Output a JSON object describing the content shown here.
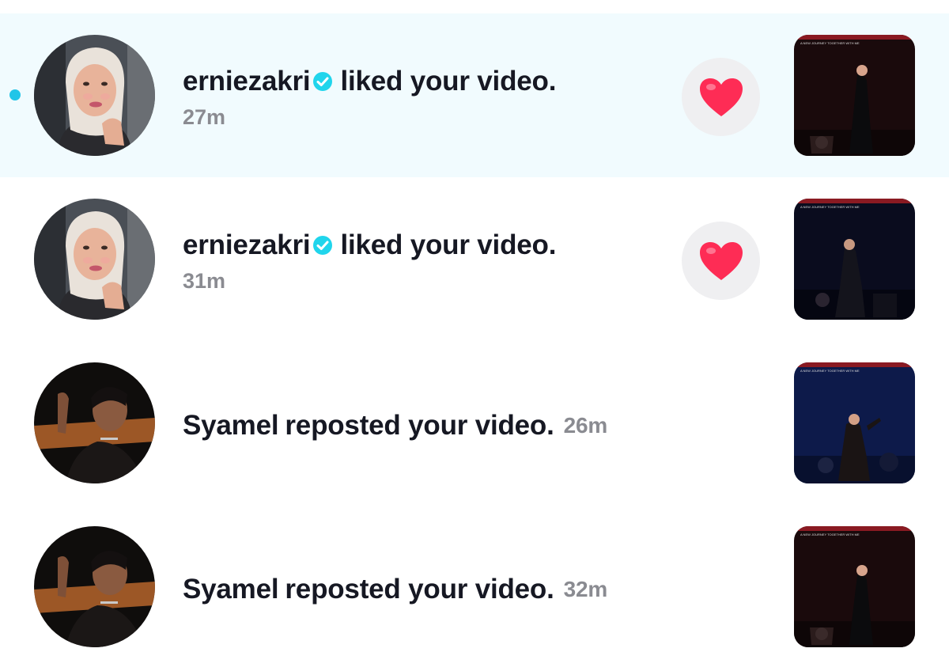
{
  "notifications": [
    {
      "username": "erniezakri",
      "verified": true,
      "action": "liked your video.",
      "time": "27m",
      "unread": true,
      "reaction_icon": "heart-icon",
      "thumb_banner": "A NEW JOURNEY TOGETHER WITH ME"
    },
    {
      "username": "erniezakri",
      "verified": true,
      "action": "liked your video.",
      "time": "31m",
      "unread": false,
      "reaction_icon": "heart-icon",
      "thumb_banner": "A NEW JOURNEY TOGETHER WITH ME"
    },
    {
      "username": "Syamel",
      "verified": false,
      "action": "reposted your video.",
      "time": "26m",
      "unread": false,
      "thumb_banner": "A NEW JOURNEY TOGETHER WITH ME"
    },
    {
      "username": "Syamel",
      "verified": false,
      "action": "reposted your video.",
      "time": "32m",
      "unread": false,
      "thumb_banner": "A NEW JOURNEY TOGETHER WITH ME"
    }
  ],
  "colors": {
    "unread_bg": "#f1fbfe",
    "unread_dot": "#21c5e8",
    "verified": "#20d5ec",
    "heart": "#fe2c55",
    "text_primary": "#161823",
    "text_secondary": "#8a8b91"
  }
}
